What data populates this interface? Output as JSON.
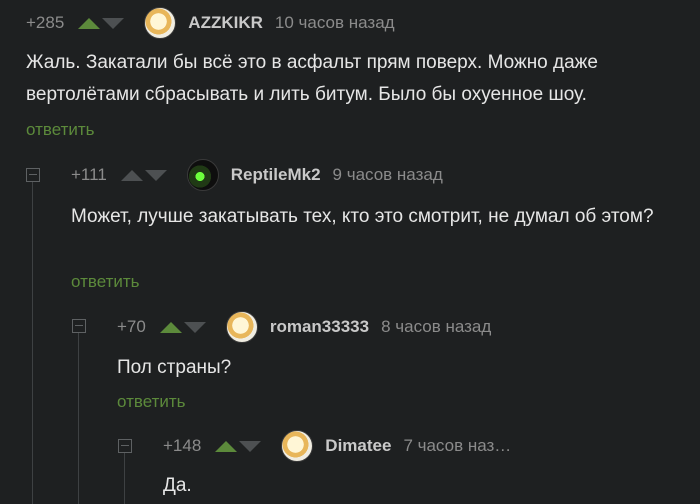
{
  "comments": [
    {
      "rating": "+285",
      "username": "AZZKIKR",
      "time": "10 часов назад",
      "text": "Жаль. Закатали бы всё это в асфальт прям поверх. Можно даже вертолётами сбрасывать и лить битум. Было бы охуенное шоу.",
      "reply": "ответить"
    },
    {
      "rating": "+111",
      "username": "ReptileMk2",
      "time": "9 часов назад",
      "text": "Может,  лучше закатывать  тех, кто это смотрит, не думал об этом?",
      "reply": "ответить"
    },
    {
      "rating": "+70",
      "username": "roman33333",
      "time": "8 часов назад",
      "text": "Пол страны?",
      "reply": "ответить"
    },
    {
      "rating": "+148",
      "username": "Dimatee",
      "time": "7 часов наз…",
      "text": "Да.",
      "reply": ""
    }
  ],
  "icons": {
    "upvote": "arrow-up-icon",
    "downvote": "arrow-down-icon",
    "collapse": "collapse-icon"
  },
  "colors": {
    "background": "#1e2021",
    "accent_green": "#5c8a3b",
    "muted_text": "#8b8b8b"
  }
}
